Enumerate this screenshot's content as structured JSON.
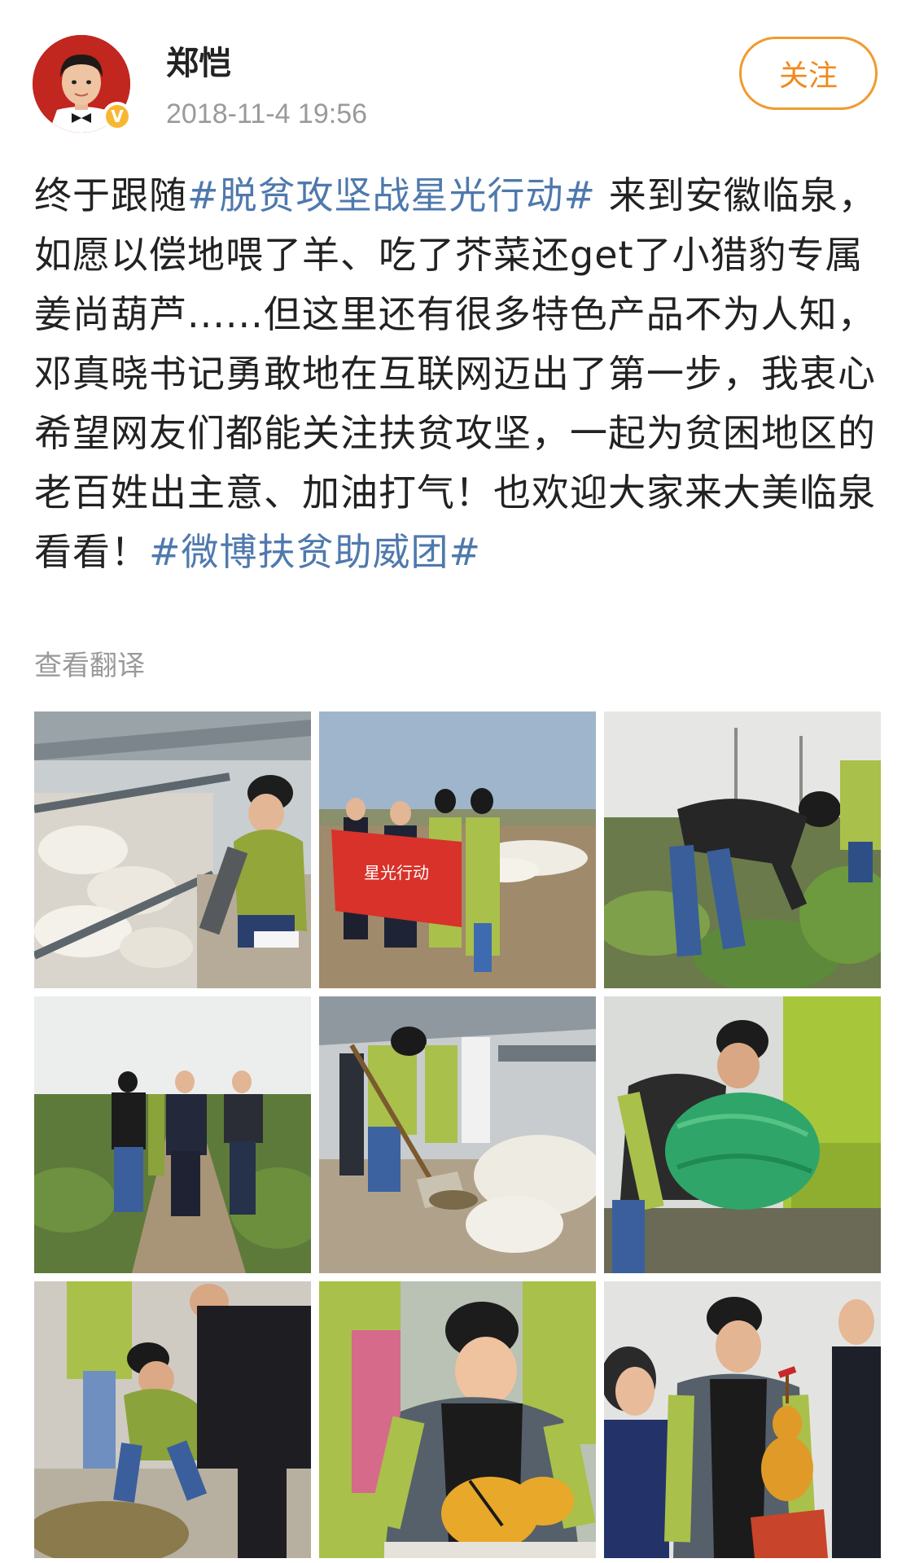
{
  "user": {
    "name": "郑恺",
    "timestamp": "2018-11-4 19:56",
    "verified": true,
    "badge_color": "#f7b733"
  },
  "follow_button": {
    "label": "关注",
    "color": "#f08a1c"
  },
  "post": {
    "segments": [
      {
        "text": "终于跟随",
        "hashtag": false
      },
      {
        "text": "#脱贫攻坚战星光行动#",
        "hashtag": true
      },
      {
        "text": " 来到安徽临泉，如愿以偿地喂了羊、吃了芥菜还get了小猎豹专属姜尚葫芦......但这里还有很多特色产品不为人知，邓真晓书记勇敢地在互联网迈出了第一步，我衷心希望网友们都能关注扶贫攻坚，一起为贫困地区的老百姓出主意、加油打气！也欢迎大家来大美临泉看看！",
        "hashtag": false
      },
      {
        "text": "#微博扶贫助威团#",
        "hashtag": true
      }
    ],
    "hashtag_color": "#4f79ad",
    "translate_label": "查看翻译"
  },
  "photos": {
    "count": 9,
    "banner_text": "星光行动"
  }
}
